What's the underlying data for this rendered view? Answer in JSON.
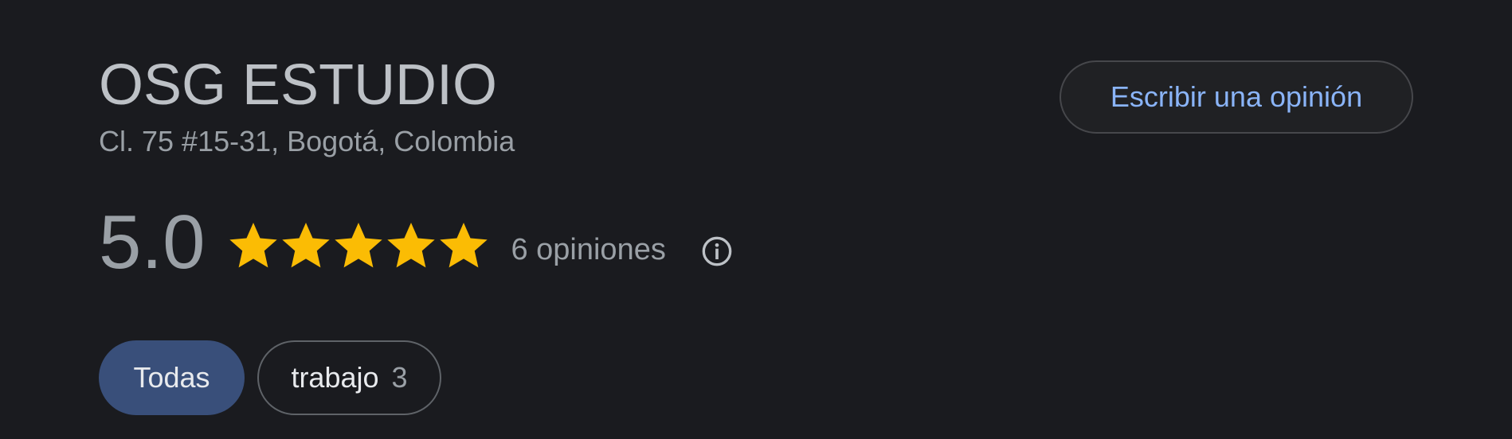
{
  "place": {
    "name": "OSG ESTUDIO",
    "address": "Cl. 75 #15-31, Bogotá, Colombia"
  },
  "actions": {
    "write_review_label": "Escribir una opinión"
  },
  "rating": {
    "score": "5.0",
    "stars_filled": 5,
    "stars_total": 5,
    "reviews_label": "6 opiniones",
    "star_color": "#fbbc04"
  },
  "info_icon": "info-circle-icon",
  "filters": [
    {
      "label": "Todas",
      "selected": true
    },
    {
      "label": "trabajo",
      "count": "3",
      "selected": false
    }
  ],
  "colors": {
    "background": "#1a1b1f",
    "link": "#8ab4f8",
    "selected_chip": "#394f7a"
  }
}
